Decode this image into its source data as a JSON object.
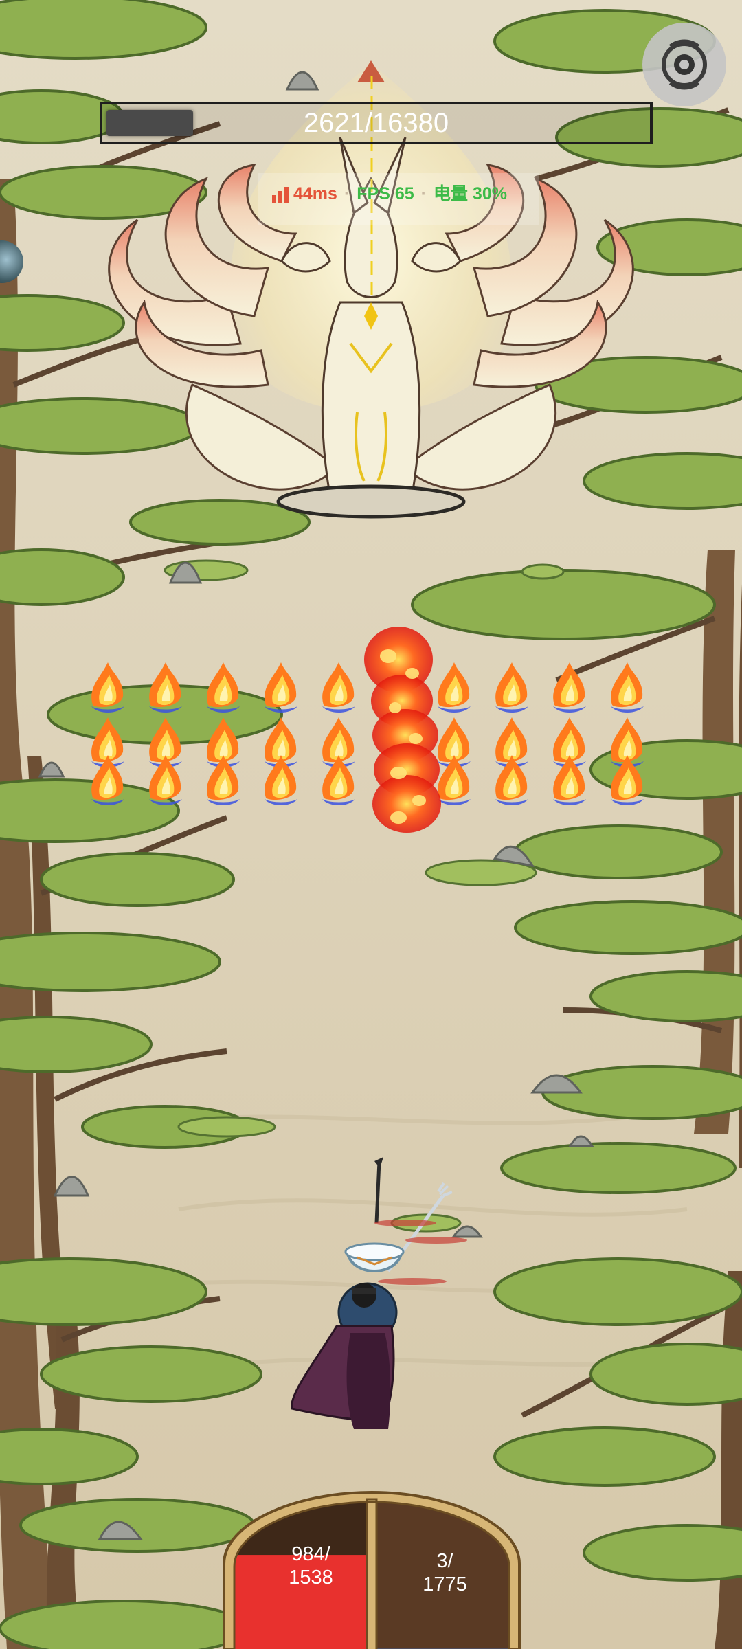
{
  "hud": {
    "boss_hp_text": "2621/16380",
    "boss_hp_current": 2621,
    "boss_hp_max": 16380,
    "perf_ping": "44ms",
    "perf_fps": "FPS 65",
    "perf_battery": "电量 30%",
    "perf_separator": "·",
    "settings_icon": "gear-icon"
  },
  "player": {
    "hp_text_line1": "984/",
    "hp_text_line2": "1538",
    "hp_current": 984,
    "hp_max": 1538,
    "mp_text_line1": "3/",
    "mp_text_line2": "1775",
    "mp_current": 3,
    "mp_max": 1775
  },
  "entities": {
    "boss": "nine-tailed-fox",
    "hero": "caped-swordsman",
    "pet": "porcelain-bowl-spirit",
    "enemy_rows": 3,
    "enemies_per_row": 10
  },
  "colors": {
    "ping": "#e4543a",
    "fps": "#3dbb48",
    "battery": "#3dbb48",
    "hp_fill": "#e8312e",
    "mp_fill": "#5a3a24",
    "bg_paper": "#e4dcc6"
  }
}
